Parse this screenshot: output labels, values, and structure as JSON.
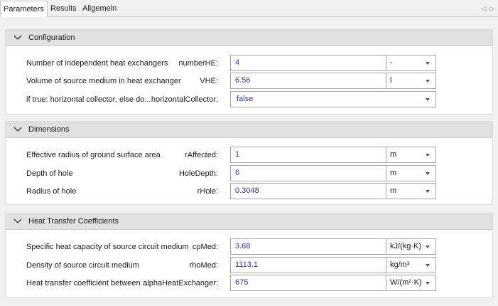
{
  "tabs": [
    {
      "label": "Parameters",
      "active": true
    },
    {
      "label": "Results",
      "active": false
    },
    {
      "label": "Allgemein",
      "active": false
    }
  ],
  "nav": {
    "prev_icon": "chevron-left-icon",
    "next_icon": "chevron-right-icon"
  },
  "groups": {
    "configuration": {
      "title": "Configuration",
      "rows": [
        {
          "desc": "Number of independent heat exchangers",
          "name": "numberHE:",
          "value": "4",
          "unit": "-"
        },
        {
          "desc": "Volume of source medium in heat exchanger",
          "name": "VHE:",
          "value": "6.56",
          "unit": "l"
        },
        {
          "desc": "if true: horizontal collector, else do...",
          "name": "horizontalCollector:",
          "value": "false"
        }
      ]
    },
    "dimensions": {
      "title": "Dimensions",
      "rows": [
        {
          "desc": "Effective radius of ground surface area",
          "name": "rAffected:",
          "value": "1",
          "unit": "m"
        },
        {
          "desc": "Depth of hole",
          "name": "HoleDepth:",
          "value": "6",
          "unit": "m"
        },
        {
          "desc": "Radius of hole",
          "name": "rHole:",
          "value": "0.3048",
          "unit": "m"
        }
      ]
    },
    "heat_transfer": {
      "title": "Heat Transfer Coefficients",
      "rows": [
        {
          "desc": "Specific heat capacity of source circuit medium",
          "name": "cpMed:",
          "value": "3.68",
          "unit": "kJ/(kg·K)"
        },
        {
          "desc": "Density of source circuit medium",
          "name": "rhoMed:",
          "value": "1113.1",
          "unit": "kg/m³"
        },
        {
          "desc": "Heat transfer coefficient between ...",
          "name": "alphaHeatExchanger:",
          "value": "675",
          "unit": "W/(m²·K)"
        }
      ]
    }
  },
  "colors": {
    "value_text": "#2a30d0",
    "header_bg": "#e1e1e1",
    "panel_bg": "#ffffff"
  }
}
